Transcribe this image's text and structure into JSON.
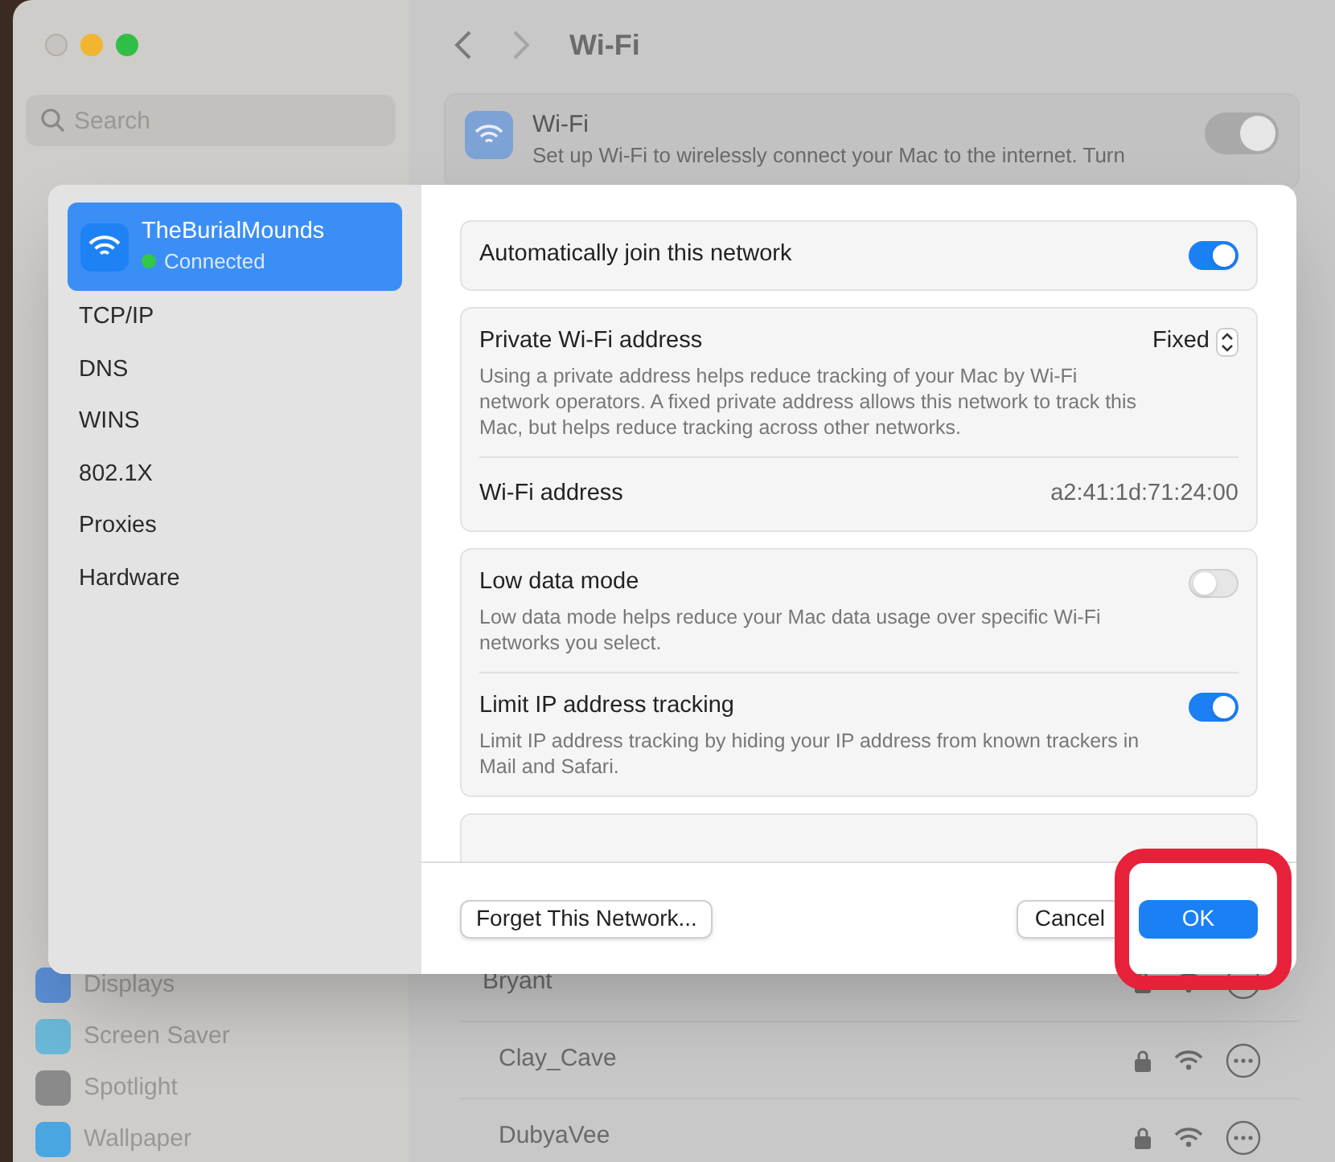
{
  "window": {
    "title": "Wi-Fi",
    "search": {
      "placeholder": "Search"
    }
  },
  "sidebar": {
    "items": [
      {
        "label": "Displays",
        "color": "#5b8fd6"
      },
      {
        "label": "Screen Saver",
        "color": "#6bb8d8"
      },
      {
        "label": "Spotlight",
        "color": "#8a8a8a"
      },
      {
        "label": "Wallpaper",
        "color": "#4aa6e0"
      }
    ]
  },
  "wifi_card": {
    "title": "Wi-Fi",
    "description": "Set up Wi-Fi to wirelessly connect your Mac to the internet. Turn",
    "on": true
  },
  "networks": [
    {
      "name": "Bryant"
    },
    {
      "name": "Clay_Cave"
    },
    {
      "name": "DubyaVee"
    }
  ],
  "dialog": {
    "network": {
      "name": "TheBurialMounds",
      "status": "Connected",
      "selected": true
    },
    "tabs": [
      {
        "label": "TCP/IP",
        "selected": false
      },
      {
        "label": "DNS",
        "selected": false
      },
      {
        "label": "WINS",
        "selected": false
      },
      {
        "label": "802.1X",
        "selected": false
      },
      {
        "label": "Proxies",
        "selected": false
      },
      {
        "label": "Hardware",
        "selected": false
      }
    ],
    "groups": [
      [
        {
          "kind": "toggle",
          "label": "Automatically join this network",
          "on": true
        }
      ],
      [
        {
          "kind": "popup",
          "label": "Private Wi-Fi address",
          "value": "Fixed",
          "description": "Using a private address helps reduce tracking of your Mac by Wi-Fi network operators. A fixed private address allows this network to track this Mac, but helps reduce tracking across other networks."
        },
        {
          "kind": "info",
          "label": "Wi-Fi address",
          "value": "a2:41:1d:71:24:00"
        }
      ],
      [
        {
          "kind": "toggle",
          "label": "Low data mode",
          "on": false,
          "description": "Low data mode helps reduce your Mac data usage over specific Wi-Fi networks you select."
        },
        {
          "kind": "toggle",
          "label": "Limit IP address tracking",
          "on": true,
          "description": "Limit IP address tracking by hiding your IP address from known trackers in Mail and Safari."
        }
      ]
    ],
    "buttons": {
      "forget": "Forget This Network...",
      "cancel": "Cancel",
      "ok": "OK"
    }
  }
}
